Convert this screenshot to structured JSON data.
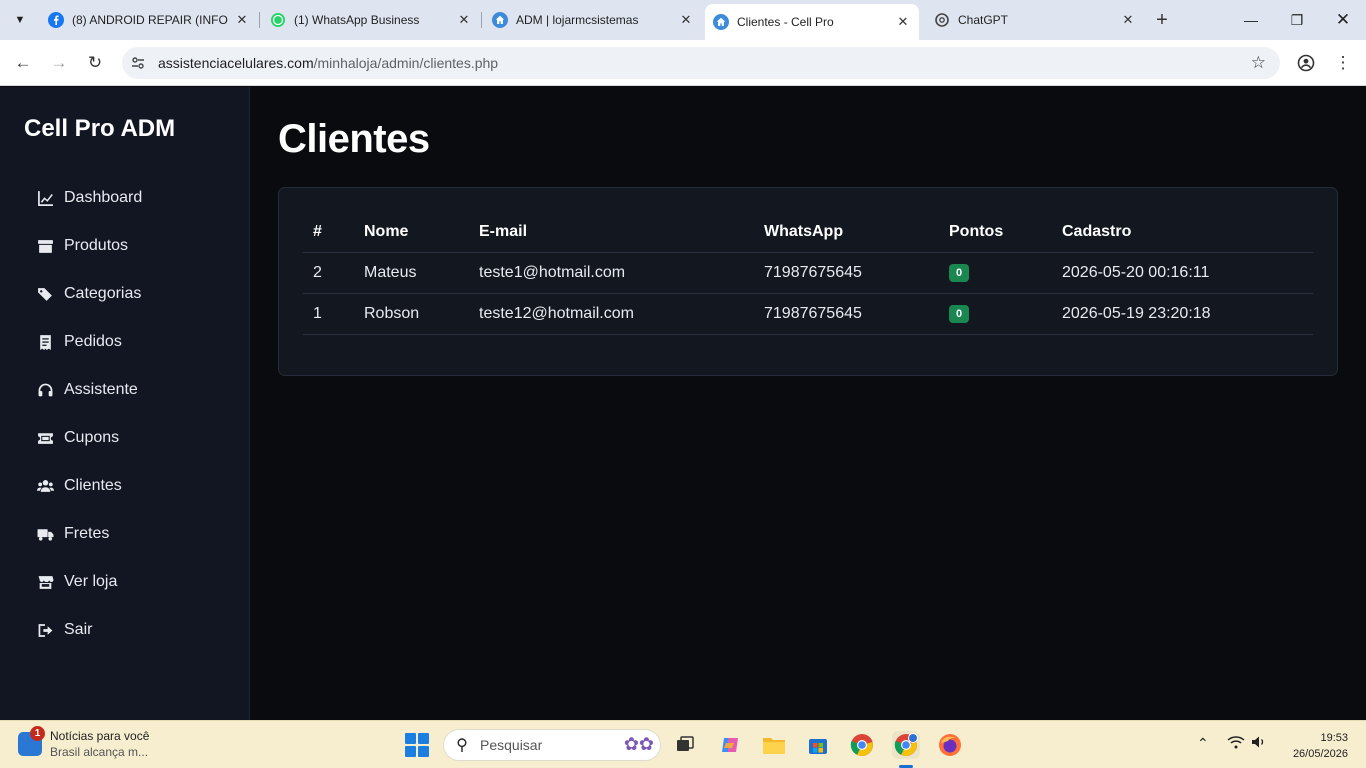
{
  "browser": {
    "tabs": [
      {
        "title": "(8) ANDROID REPAIR (INFO…",
        "icon": "facebook-icon"
      },
      {
        "title": "(1) WhatsApp Business",
        "icon": "whatsapp-icon"
      },
      {
        "title": "ADM | lojarmcsistemas",
        "icon": "home-icon"
      },
      {
        "title": "Clientes - Cell Pro",
        "icon": "home-icon",
        "active": true
      },
      {
        "title": "ChatGPT",
        "icon": "chatgpt-icon"
      }
    ],
    "url_host": "assistenciacelulares.com",
    "url_path": "/minhaloja/admin/clientes.php"
  },
  "sidebar": {
    "brand": "Cell Pro ADM",
    "items": [
      {
        "label": "Dashboard",
        "icon": "chart-line-icon"
      },
      {
        "label": "Produtos",
        "icon": "box-icon"
      },
      {
        "label": "Categorias",
        "icon": "tags-icon"
      },
      {
        "label": "Pedidos",
        "icon": "receipt-icon"
      },
      {
        "label": "Assistente",
        "icon": "headset-icon"
      },
      {
        "label": "Cupons",
        "icon": "ticket-icon"
      },
      {
        "label": "Clientes",
        "icon": "users-icon"
      },
      {
        "label": "Fretes",
        "icon": "truck-icon"
      },
      {
        "label": "Ver loja",
        "icon": "store-icon"
      },
      {
        "label": "Sair",
        "icon": "sign-out-icon"
      }
    ]
  },
  "main": {
    "title": "Clientes",
    "table": {
      "headers": [
        "#",
        "Nome",
        "E-mail",
        "WhatsApp",
        "Pontos",
        "Cadastro"
      ],
      "rows": [
        {
          "id": "2",
          "nome": "Mateus",
          "email": "teste1@hotmail.com",
          "whatsapp": "71987675645",
          "pontos": "0",
          "cadastro": "2026-05-20 00:16:11"
        },
        {
          "id": "1",
          "nome": "Robson",
          "email": "teste12@hotmail.com",
          "whatsapp": "71987675645",
          "pontos": "0",
          "cadastro": "2026-05-19 23:20:18"
        }
      ]
    }
  },
  "taskbar": {
    "news_title": "Notícias para você",
    "news_subtitle": "Brasil alcança m...",
    "news_badge": "1",
    "search_placeholder": "Pesquisar",
    "time": "19:53",
    "date": "26/05/2026"
  },
  "colors": {
    "sidebar_bg": "#111622",
    "main_bg": "#0a0b0e",
    "card_bg": "#131720",
    "badge_green": "#19874f"
  }
}
